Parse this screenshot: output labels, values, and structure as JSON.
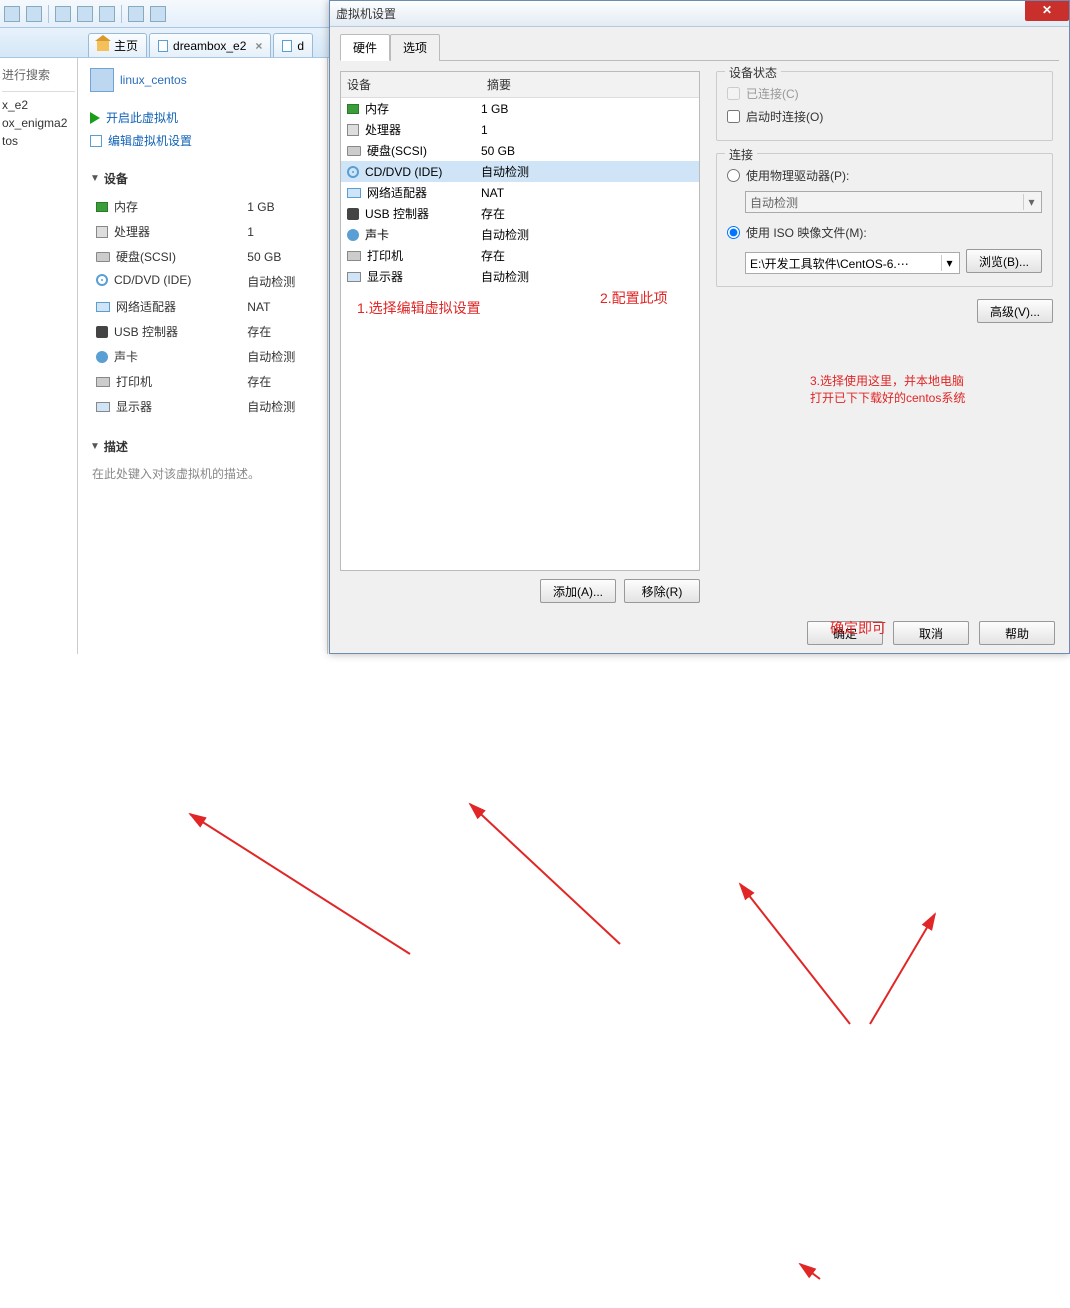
{
  "top_menu_items": [
    "",
    "",
    "",
    ""
  ],
  "tabs": {
    "home": "主页",
    "dreambox": "dreambox_e2",
    "d_partial": "d"
  },
  "left_tree": {
    "search": "进行搜索",
    "items": [
      "x_e2",
      "ox_enigma2",
      "tos"
    ]
  },
  "vm": {
    "title": "linux_centos",
    "power_on": "开启此虚拟机",
    "edit_settings": "编辑虚拟机设置",
    "devices_header": "设备",
    "desc_header": "描述",
    "desc_placeholder": "在此处键入对该虚拟机的描述。"
  },
  "hw_rows": [
    {
      "icon": "ic-mem",
      "name": "内存",
      "val": "1 GB"
    },
    {
      "icon": "ic-cpu",
      "name": "处理器",
      "val": "1"
    },
    {
      "icon": "ic-disk",
      "name": "硬盘(SCSI)",
      "val": "50 GB"
    },
    {
      "icon": "ic-cd",
      "name": "CD/DVD (IDE)",
      "val": "自动检测"
    },
    {
      "icon": "ic-net",
      "name": "网络适配器",
      "val": "NAT"
    },
    {
      "icon": "ic-usb",
      "name": "USB 控制器",
      "val": "存在"
    },
    {
      "icon": "ic-snd",
      "name": "声卡",
      "val": "自动检测"
    },
    {
      "icon": "ic-prn",
      "name": "打印机",
      "val": "存在"
    },
    {
      "icon": "ic-mon",
      "name": "显示器",
      "val": "自动检测"
    }
  ],
  "dialog": {
    "title": "虚拟机设置",
    "tab_hw": "硬件",
    "tab_opt": "选项",
    "col_device": "设备",
    "col_summary": "摘要",
    "rows": [
      {
        "icon": "ic-mem",
        "name": "内存",
        "val": "1 GB"
      },
      {
        "icon": "ic-cpu",
        "name": "处理器",
        "val": "1"
      },
      {
        "icon": "ic-disk",
        "name": "硬盘(SCSI)",
        "val": "50 GB"
      },
      {
        "icon": "ic-cd",
        "name": "CD/DVD (IDE)",
        "val": "自动检测",
        "selected": true
      },
      {
        "icon": "ic-net",
        "name": "网络适配器",
        "val": "NAT"
      },
      {
        "icon": "ic-usb",
        "name": "USB 控制器",
        "val": "存在"
      },
      {
        "icon": "ic-snd",
        "name": "声卡",
        "val": "自动检测"
      },
      {
        "icon": "ic-prn",
        "name": "打印机",
        "val": "存在"
      },
      {
        "icon": "ic-mon",
        "name": "显示器",
        "val": "自动检测"
      }
    ],
    "add_btn": "添加(A)...",
    "remove_btn": "移除(R)",
    "status_legend": "设备状态",
    "chk_connected": "已连接(C)",
    "chk_boot": "启动时连接(O)",
    "conn_legend": "连接",
    "radio_physical": "使用物理驱动器(P):",
    "physical_combo": "自动检测",
    "radio_iso": "使用 ISO 映像文件(M):",
    "iso_path": "E:\\开发工具软件\\CentOS-6.⋯",
    "browse_btn": "浏览(B)...",
    "advanced_btn": "高级(V)...",
    "ok_btn": "确定",
    "cancel_btn": "取消",
    "help_btn": "帮助"
  },
  "annotations": {
    "a1": "1.选择编辑虚拟设置",
    "a2": "2.配置此项",
    "a3_l1": "3.选择使用这里，并本地电脑",
    "a3_l2": "打开已下下载好的centos系统",
    "a4": "确定即可"
  }
}
